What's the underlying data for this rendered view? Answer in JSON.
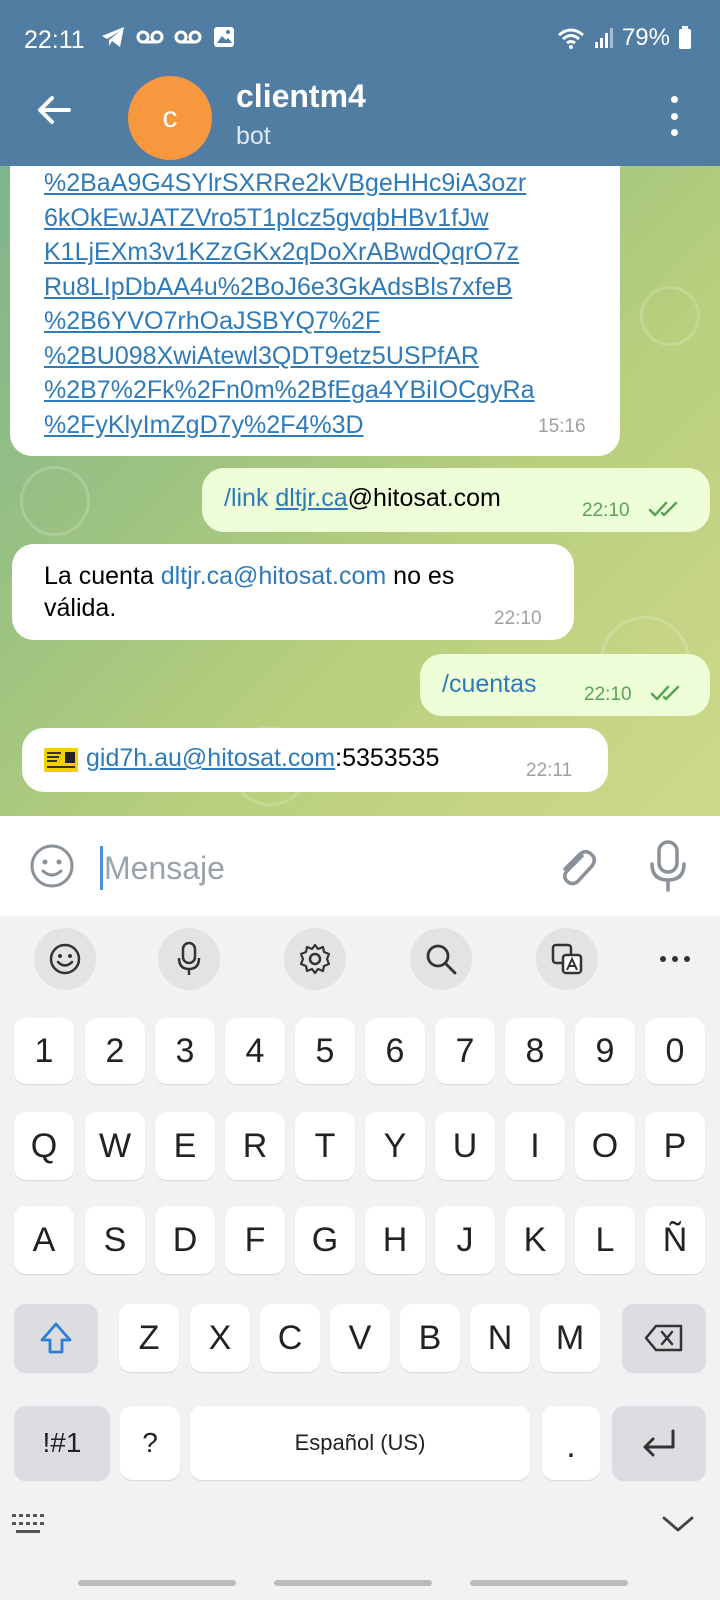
{
  "status_bar": {
    "time": "22:11",
    "battery": "79%"
  },
  "app_bar": {
    "avatar_letter": "c",
    "title": "clientm4",
    "subtitle": "bot"
  },
  "messages": {
    "m1": {
      "lines": [
        "%2BaA9G4SYlrSXRRe2kVBgeHHc9iA3ozr",
        "6kOkEwJATZVro5T1pIcz5gvqbHBv1fJw",
        "K1LjEXm3v1KZzGKx2qDoXrABwdQqrO7z",
        "Ru8LIpDbAA4u%2BoJ6e3GkAdsBls7xfeB",
        "%2B6YVO7rhOaJSBYQ7%2F",
        "%2BU098XwiAtewl3QDT9etz5USPfAR",
        "%2B7%2Fk%2Fn0m%2BfEga4YBiIOCgyRa",
        "%2FyKlyImZgD7y%2F4%3D"
      ],
      "time": "15:16"
    },
    "m2": {
      "cmd": "/link ",
      "link": "dltjr.ca",
      "rest": "@hitosat.com",
      "time": "22:10"
    },
    "m3": {
      "prefix": "La cuenta ",
      "email": "dltjr.ca@hitosat.com",
      "suffix": " no es",
      "line2": "válida.",
      "time": "22:10"
    },
    "m4": {
      "text": "/cuentas",
      "time": "22:10"
    },
    "m5": {
      "email": "gid7h.au@hitosat.com",
      "rest": ":5353535",
      "time": "22:11"
    }
  },
  "input": {
    "placeholder": "Mensaje"
  },
  "keyboard": {
    "row_numbers": [
      "1",
      "2",
      "3",
      "4",
      "5",
      "6",
      "7",
      "8",
      "9",
      "0"
    ],
    "row_1": [
      "Q",
      "W",
      "E",
      "R",
      "T",
      "Y",
      "U",
      "I",
      "O",
      "P"
    ],
    "row_2": [
      "A",
      "S",
      "D",
      "F",
      "G",
      "H",
      "J",
      "K",
      "L",
      "Ñ"
    ],
    "row_3": [
      "Z",
      "X",
      "C",
      "V",
      "B",
      "N",
      "M"
    ],
    "symbols_key": "!#1",
    "question_key": "?",
    "space_label": "Español (US)",
    "period_key": "."
  },
  "colors": {
    "header": "#527DA3",
    "avatar": "#F7973E",
    "link": "#2f7ab8",
    "outgoing_bubble": "#eefed9",
    "outgoing_time": "#5aa352"
  }
}
